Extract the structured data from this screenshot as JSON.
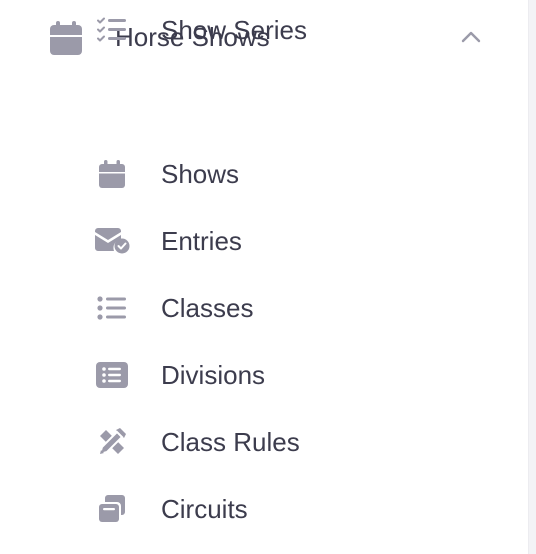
{
  "colors": {
    "icon": "#9b9aa9",
    "text": "#3c3c4d"
  },
  "group": {
    "label": "Horse Shows",
    "icon": "calendar-icon",
    "expanded": true,
    "chevron_icon": "chevron-up-icon"
  },
  "items": [
    {
      "label": "Shows",
      "icon": "calendar-icon"
    },
    {
      "label": "Entries",
      "icon": "envelope-check-icon"
    },
    {
      "label": "Classes",
      "icon": "list-icon"
    },
    {
      "label": "Divisions",
      "icon": "list-box-icon"
    },
    {
      "label": "Class Rules",
      "icon": "pencil-ruler-icon"
    },
    {
      "label": "Circuits",
      "icon": "copy-icon"
    },
    {
      "label": "Show Series",
      "icon": "list-check-icon"
    }
  ]
}
